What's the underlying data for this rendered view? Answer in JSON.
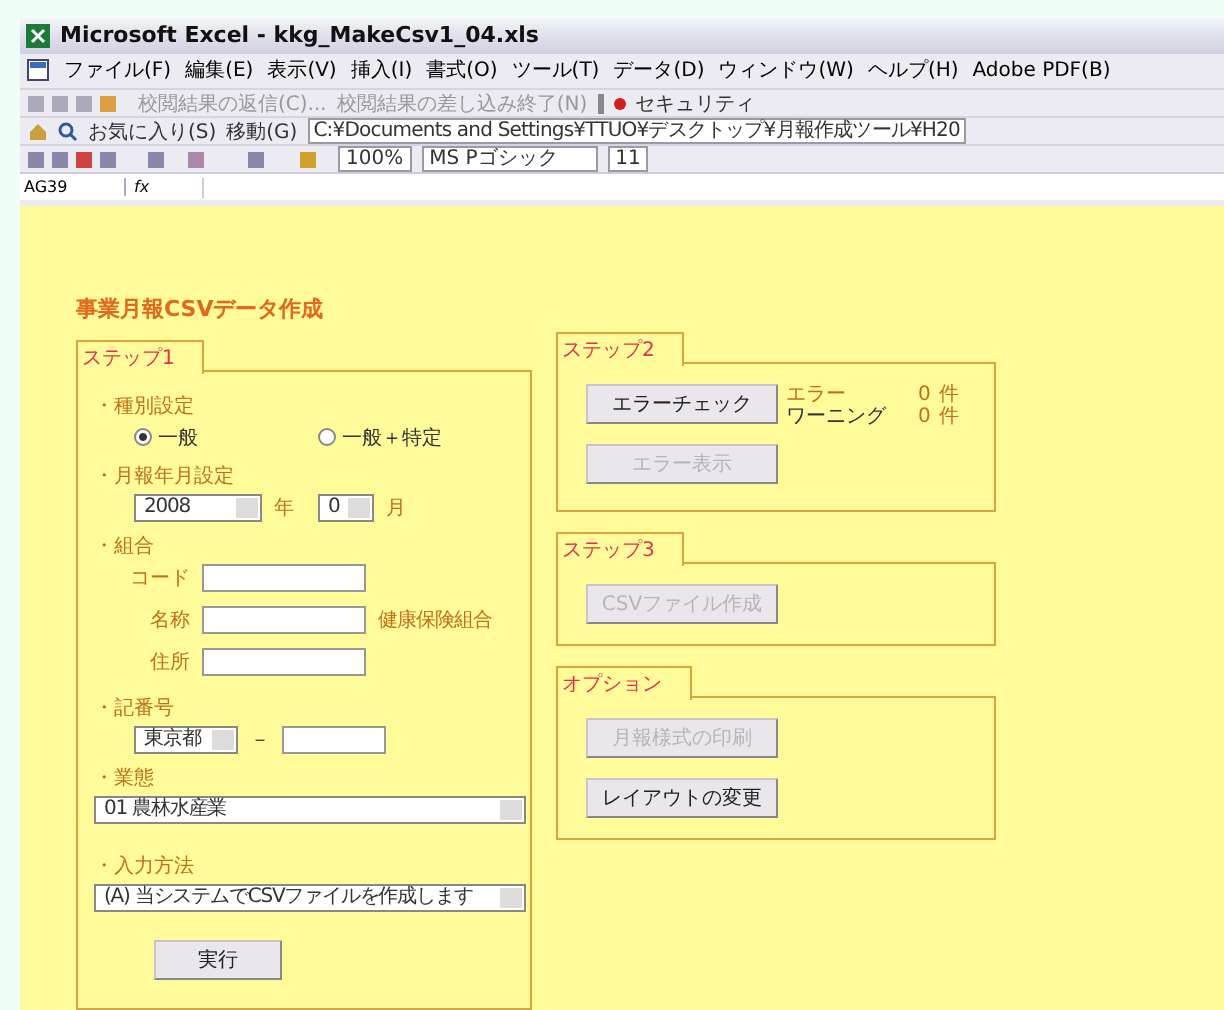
{
  "window": {
    "title": "Microsoft Excel - kkg_MakeCsv1_04.xls"
  },
  "menu": [
    "ファイル(F)",
    "編集(E)",
    "表示(V)",
    "挿入(I)",
    "書式(O)",
    "ツール(T)",
    "データ(D)",
    "ウィンドウ(W)",
    "ヘルプ(H)",
    "Adobe PDF(B)"
  ],
  "toolbar_review": {
    "items": [
      "校閲結果の返信(C)...",
      "校閲結果の差し込み終了(N)"
    ],
    "security": "セキュリティ"
  },
  "toolbar_web": {
    "favorites": "お気に入り(S)",
    "go": "移動(G)",
    "address": "C:¥Documents and Settings¥TTUO¥デスクトップ¥月報作成ツール¥H20"
  },
  "toolbar_format": {
    "zoom": "100%",
    "font": "MS Pゴシック",
    "size": "11"
  },
  "formula_bar": {
    "name_box": "AG39",
    "fx": "fx"
  },
  "sheet": {
    "title": "事業月報CSVデータ作成",
    "step1": {
      "tab": "ステップ1",
      "type": {
        "label": "・種別設定",
        "options": [
          {
            "label": "一般",
            "selected": true
          },
          {
            "label": "一般＋特定",
            "selected": false
          }
        ]
      },
      "period": {
        "label": "・月報年月設定",
        "year": "2008",
        "year_unit": "年",
        "month": "0",
        "month_unit": "月"
      },
      "union": {
        "label": "・組合",
        "fields": [
          {
            "label": "コード"
          },
          {
            "label": "名称",
            "suffix": "健康保険組合"
          },
          {
            "label": "住所"
          }
        ]
      },
      "symbol": {
        "label": "・記番号",
        "prefecture": "東京都",
        "dash": "－"
      },
      "industry": {
        "label": "・業態",
        "value": "01 農林水産業"
      },
      "method": {
        "label": "・入力方法",
        "value": "(A) 当システムでCSVファイルを作成します"
      },
      "run": "実行"
    },
    "step2": {
      "tab": "ステップ2",
      "buttons": [
        {
          "label": "エラーチェック",
          "disabled": false
        },
        {
          "label": "エラー表示",
          "disabled": true
        }
      ],
      "counts": [
        {
          "label": "エラー",
          "value": "0",
          "unit": "件"
        },
        {
          "label": "ワーニング",
          "value": "0",
          "unit": "件"
        }
      ]
    },
    "step3": {
      "tab": "ステップ3",
      "buttons": [
        {
          "label": "CSVファイル作成",
          "disabled": true
        }
      ]
    },
    "options": {
      "tab": "オプション",
      "buttons": [
        {
          "label": "月報様式の印刷",
          "disabled": true
        },
        {
          "label": "レイアウトの変更",
          "disabled": false
        }
      ]
    }
  }
}
